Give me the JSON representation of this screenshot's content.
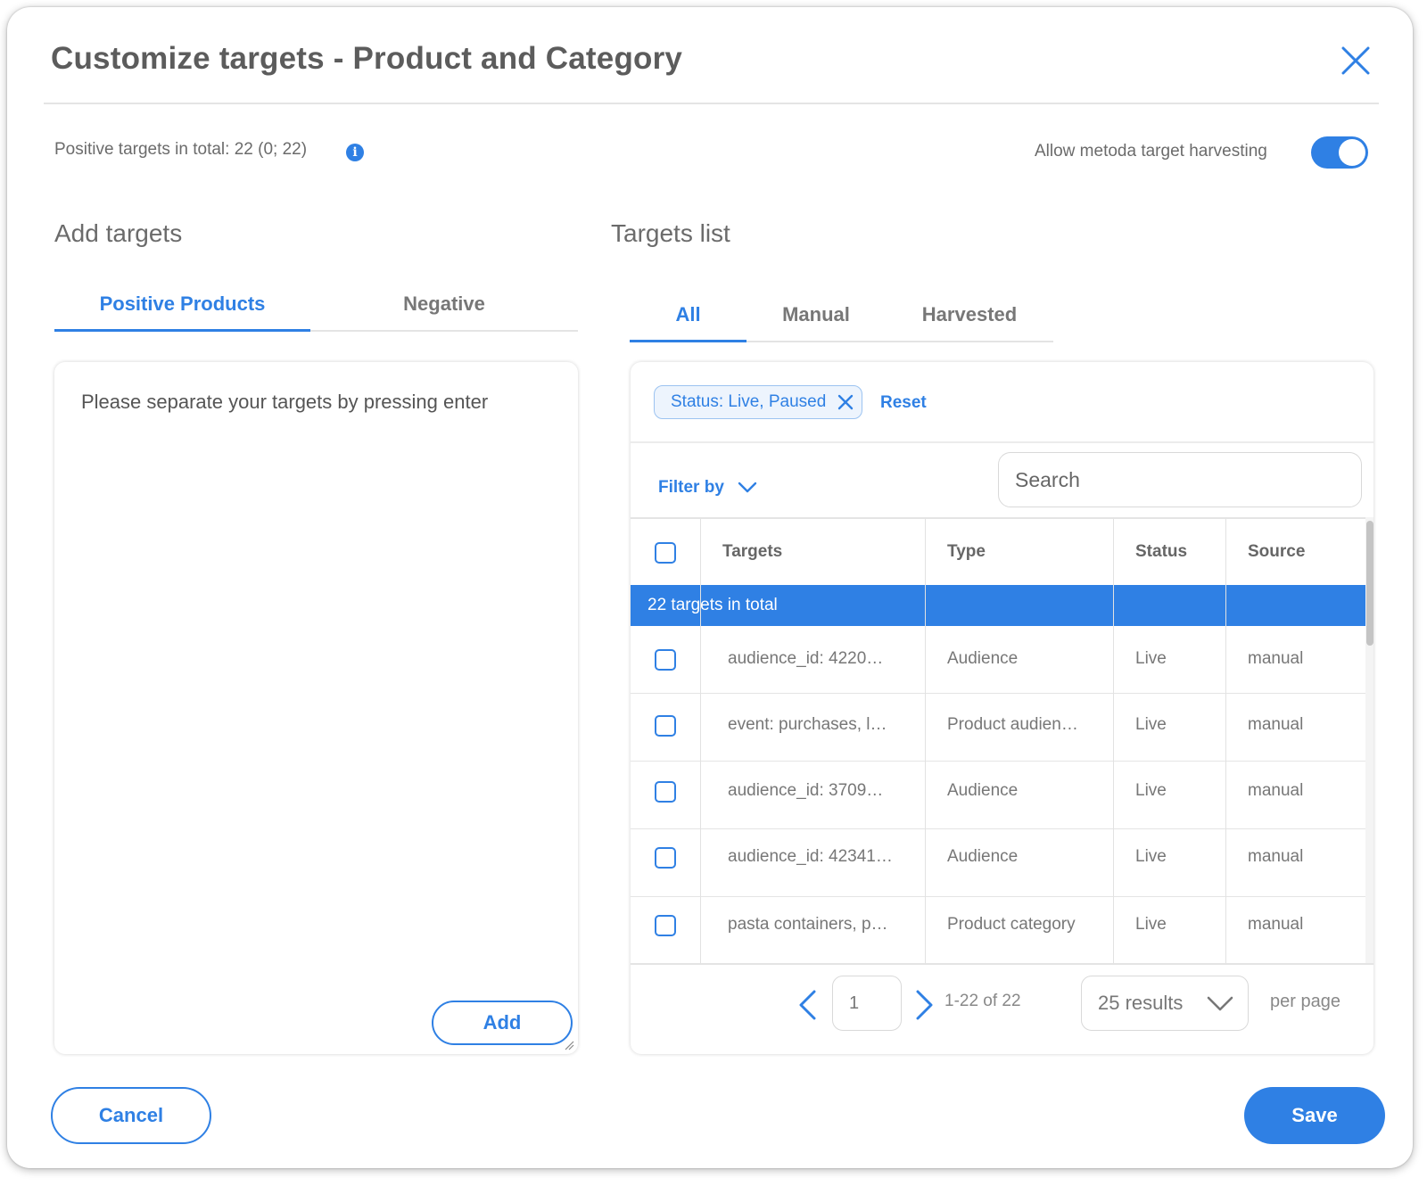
{
  "dialog": {
    "title": "Customize targets - Product and Category",
    "close_icon": "close-icon"
  },
  "summary": {
    "positive_total_text": "Positive targets in total: 22 (0; 22)",
    "info_icon": "info-icon",
    "info_glyph": "i"
  },
  "harvesting": {
    "label": "Allow metoda target harvesting",
    "enabled": true
  },
  "add_targets": {
    "title": "Add targets",
    "tabs": [
      {
        "label": "Positive Products",
        "active": true
      },
      {
        "label": "Negative",
        "active": false
      }
    ],
    "textarea_placeholder": "Please separate your targets by pressing enter",
    "add_label": "Add"
  },
  "targets_list": {
    "title": "Targets list",
    "tabs": [
      {
        "label": "All",
        "active": true
      },
      {
        "label": "Manual",
        "active": false
      },
      {
        "label": "Harvested",
        "active": false
      }
    ],
    "filter_chip": "Status: Live, Paused",
    "reset_label": "Reset",
    "filter_by_label": "Filter by",
    "search_placeholder": "Search",
    "columns": [
      "Targets",
      "Type",
      "Status",
      "Source"
    ],
    "total_row": "22 targets in total",
    "rows": [
      {
        "target": "audience_id: 4220…",
        "type": "Audience",
        "status": "Live",
        "source": "manual"
      },
      {
        "target": "event: purchases, l…",
        "type": "Product audien…",
        "status": "Live",
        "source": "manual"
      },
      {
        "target": "audience_id: 3709…",
        "type": "Audience",
        "status": "Live",
        "source": "manual"
      },
      {
        "target": "audience_id: 42341…",
        "type": "Audience",
        "status": "Live",
        "source": "manual"
      },
      {
        "target": "pasta containers, p…",
        "type": "Product category",
        "status": "Live",
        "source": "manual"
      }
    ],
    "pagination": {
      "page": "1",
      "range": "1-22 of 22",
      "results_per_page": "25 results",
      "per_page_label": "per page"
    }
  },
  "footer": {
    "cancel_label": "Cancel",
    "save_label": "Save"
  },
  "colors": {
    "accent": "#2f80e4",
    "text": "#5c5c5c"
  }
}
